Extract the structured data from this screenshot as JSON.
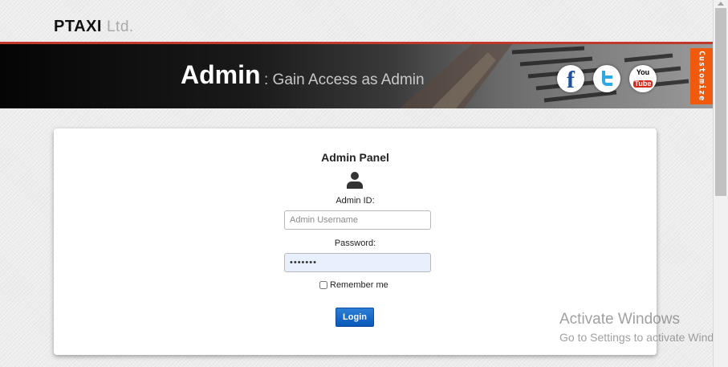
{
  "brand": {
    "name": "PTAXI",
    "suffix": "Ltd."
  },
  "banner": {
    "title": "Admin",
    "subtitle": ": Gain Access as Admin"
  },
  "social": {
    "facebook": {
      "icon": "facebook-icon",
      "glyph": "f",
      "color": "#1d4fa2"
    },
    "twitter": {
      "icon": "twitter-icon",
      "color": "#2fa9e0"
    },
    "youtube": {
      "icon": "youtube-icon",
      "you": "You",
      "tube": "Tube",
      "color": "#d62a1e"
    }
  },
  "customize": {
    "label": "Customize",
    "color": "#f15a0c"
  },
  "panel": {
    "title": "Admin Panel",
    "user_icon": "user-icon",
    "admin_id_label": "Admin ID:",
    "admin_id_placeholder": "Admin Username",
    "admin_id_value": "",
    "password_label": "Password:",
    "password_value": "•••••••",
    "remember_label": "Remember me",
    "remember_checked": false,
    "login_label": "Login"
  },
  "watermark": {
    "title": "Activate Windows",
    "subtitle": "Go to Settings to activate Windows."
  },
  "colors": {
    "accent": "#c0392b",
    "button": "#0a57b8"
  }
}
